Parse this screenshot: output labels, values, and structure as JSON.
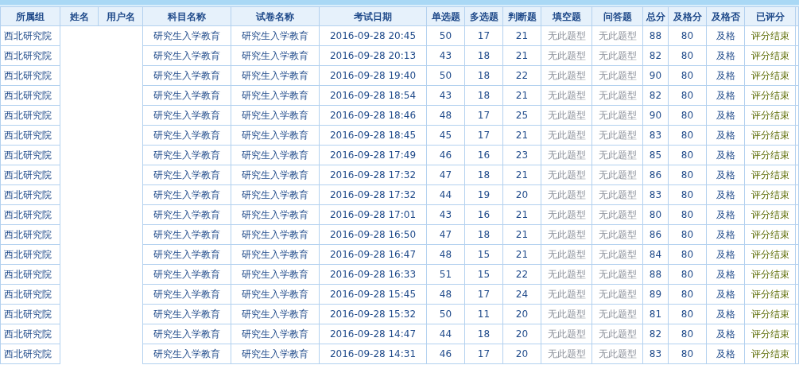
{
  "table": {
    "columns": [
      {
        "label": "所属组",
        "kind": "left"
      },
      {
        "label": "姓名",
        "kind": "blank"
      },
      {
        "label": "用户名",
        "kind": "blank"
      },
      {
        "label": "科目名称",
        "kind": "plain"
      },
      {
        "label": "试卷名称",
        "kind": "plain"
      },
      {
        "label": "考试日期",
        "kind": "plain"
      },
      {
        "label": "单选题",
        "kind": "plain"
      },
      {
        "label": "多选题",
        "kind": "plain"
      },
      {
        "label": "判断题",
        "kind": "plain"
      },
      {
        "label": "填空题",
        "kind": "muted"
      },
      {
        "label": "问答题",
        "kind": "muted"
      },
      {
        "label": "总分",
        "kind": "plain"
      },
      {
        "label": "及格分",
        "kind": "plain"
      },
      {
        "label": "及格否",
        "kind": "plain"
      },
      {
        "label": "已评分",
        "kind": "status"
      }
    ],
    "rows": [
      [
        "西北研究院",
        "",
        "",
        "研究生入学教育",
        "研究生入学教育",
        "2016-09-28 20:45",
        "50",
        "17",
        "21",
        "无此题型",
        "无此题型",
        "88",
        "80",
        "及格",
        "评分结束"
      ],
      [
        "西北研究院",
        "",
        "",
        "研究生入学教育",
        "研究生入学教育",
        "2016-09-28 20:13",
        "43",
        "18",
        "21",
        "无此题型",
        "无此题型",
        "82",
        "80",
        "及格",
        "评分结束"
      ],
      [
        "西北研究院",
        "",
        "",
        "研究生入学教育",
        "研究生入学教育",
        "2016-09-28 19:40",
        "50",
        "18",
        "22",
        "无此题型",
        "无此题型",
        "90",
        "80",
        "及格",
        "评分结束"
      ],
      [
        "西北研究院",
        "",
        "",
        "研究生入学教育",
        "研究生入学教育",
        "2016-09-28 18:54",
        "43",
        "18",
        "21",
        "无此题型",
        "无此题型",
        "82",
        "80",
        "及格",
        "评分结束"
      ],
      [
        "西北研究院",
        "",
        "",
        "研究生入学教育",
        "研究生入学教育",
        "2016-09-28 18:46",
        "48",
        "17",
        "25",
        "无此题型",
        "无此题型",
        "90",
        "80",
        "及格",
        "评分结束"
      ],
      [
        "西北研究院",
        "",
        "",
        "研究生入学教育",
        "研究生入学教育",
        "2016-09-28 18:45",
        "45",
        "17",
        "21",
        "无此题型",
        "无此题型",
        "83",
        "80",
        "及格",
        "评分结束"
      ],
      [
        "西北研究院",
        "",
        "",
        "研究生入学教育",
        "研究生入学教育",
        "2016-09-28 17:49",
        "46",
        "16",
        "23",
        "无此题型",
        "无此题型",
        "85",
        "80",
        "及格",
        "评分结束"
      ],
      [
        "西北研究院",
        "",
        "",
        "研究生入学教育",
        "研究生入学教育",
        "2016-09-28 17:32",
        "47",
        "18",
        "21",
        "无此题型",
        "无此题型",
        "86",
        "80",
        "及格",
        "评分结束"
      ],
      [
        "西北研究院",
        "",
        "",
        "研究生入学教育",
        "研究生入学教育",
        "2016-09-28 17:32",
        "44",
        "19",
        "20",
        "无此题型",
        "无此题型",
        "83",
        "80",
        "及格",
        "评分结束"
      ],
      [
        "西北研究院",
        "",
        "",
        "研究生入学教育",
        "研究生入学教育",
        "2016-09-28 17:01",
        "43",
        "16",
        "21",
        "无此题型",
        "无此题型",
        "80",
        "80",
        "及格",
        "评分结束"
      ],
      [
        "西北研究院",
        "",
        "",
        "研究生入学教育",
        "研究生入学教育",
        "2016-09-28 16:50",
        "47",
        "18",
        "21",
        "无此题型",
        "无此题型",
        "86",
        "80",
        "及格",
        "评分结束"
      ],
      [
        "西北研究院",
        "",
        "",
        "研究生入学教育",
        "研究生入学教育",
        "2016-09-28 16:47",
        "48",
        "15",
        "21",
        "无此题型",
        "无此题型",
        "84",
        "80",
        "及格",
        "评分结束"
      ],
      [
        "西北研究院",
        "",
        "",
        "研究生入学教育",
        "研究生入学教育",
        "2016-09-28 16:33",
        "51",
        "15",
        "22",
        "无此题型",
        "无此题型",
        "88",
        "80",
        "及格",
        "评分结束"
      ],
      [
        "西北研究院",
        "",
        "",
        "研究生入学教育",
        "研究生入学教育",
        "2016-09-28 15:45",
        "48",
        "17",
        "24",
        "无此题型",
        "无此题型",
        "89",
        "80",
        "及格",
        "评分结束"
      ],
      [
        "西北研究院",
        "",
        "",
        "研究生入学教育",
        "研究生入学教育",
        "2016-09-28 15:32",
        "50",
        "11",
        "20",
        "无此题型",
        "无此题型",
        "81",
        "80",
        "及格",
        "评分结束"
      ],
      [
        "西北研究院",
        "",
        "",
        "研究生入学教育",
        "研究生入学教育",
        "2016-09-28 14:47",
        "44",
        "18",
        "20",
        "无此题型",
        "无此题型",
        "82",
        "80",
        "及格",
        "评分结束"
      ],
      [
        "西北研究院",
        "",
        "",
        "研究生入学教育",
        "研究生入学教育",
        "2016-09-28 14:31",
        "46",
        "17",
        "20",
        "无此题型",
        "无此题型",
        "83",
        "80",
        "及格",
        "评分结束"
      ]
    ]
  }
}
